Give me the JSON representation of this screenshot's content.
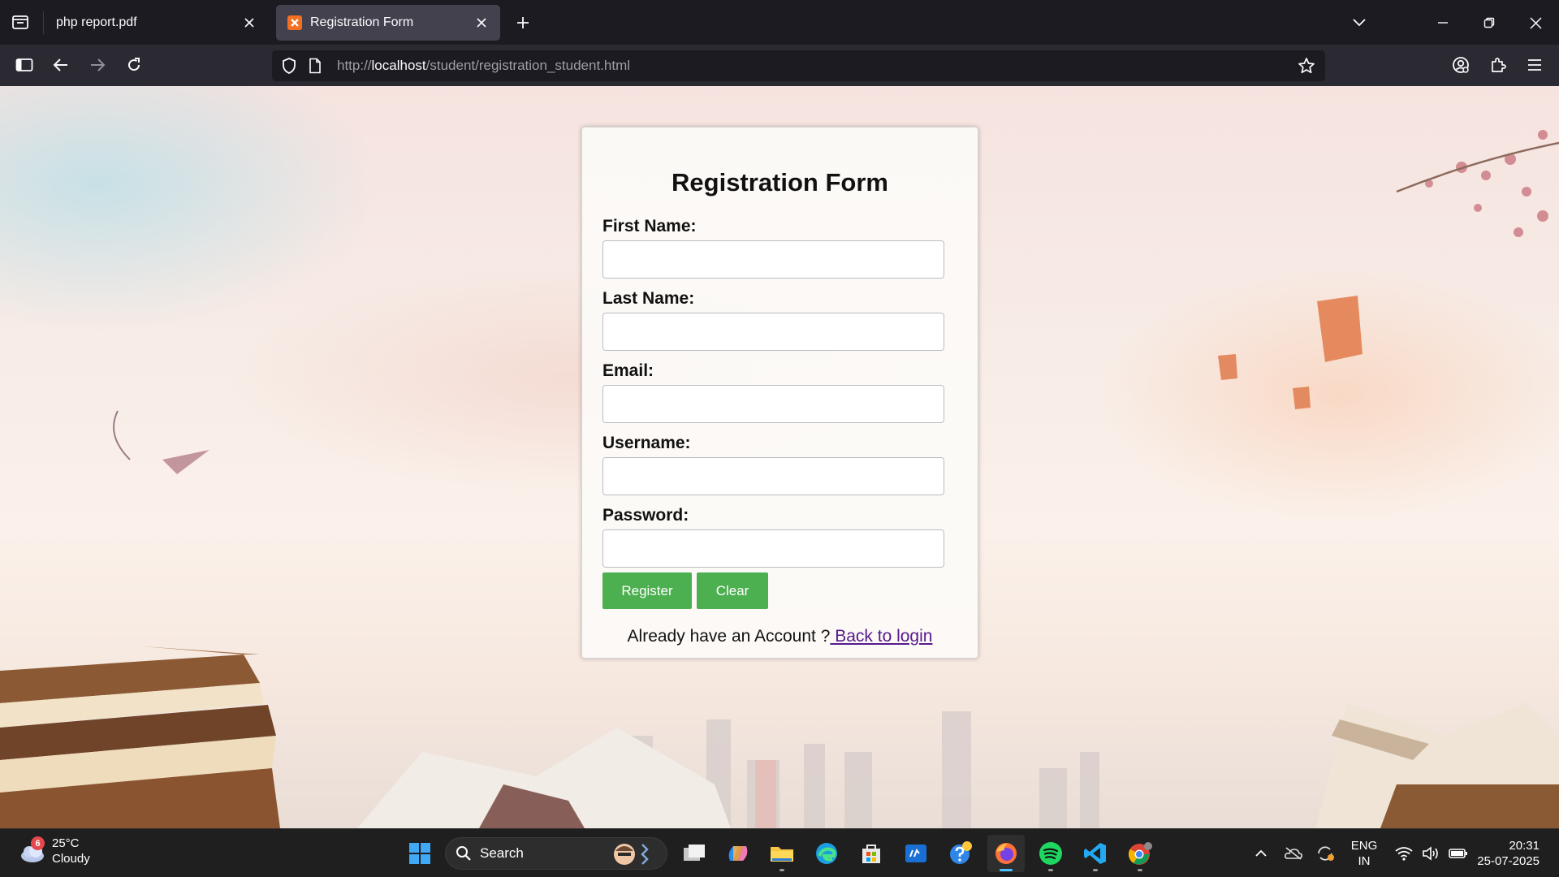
{
  "browser": {
    "tabs": [
      {
        "title": "php report.pdf",
        "active": false
      },
      {
        "title": "Registration Form",
        "active": true
      }
    ],
    "url": {
      "prefix": "http://",
      "host": "localhost",
      "path": "/student/registration_student.html"
    }
  },
  "form": {
    "title": "Registration Form",
    "fields": [
      {
        "label": "First Name:",
        "value": ""
      },
      {
        "label": "Last Name:",
        "value": ""
      },
      {
        "label": "Email:",
        "value": ""
      },
      {
        "label": "Username:",
        "value": ""
      },
      {
        "label": "Password:",
        "value": ""
      }
    ],
    "register_label": "Register",
    "clear_label": "Clear",
    "login_prompt": "Already have an Account ?",
    "login_link": " Back to login",
    "button_color": "#4caf50"
  },
  "taskbar": {
    "weather": {
      "temp": "25°C",
      "condition": "Cloudy",
      "badge": "6"
    },
    "search_placeholder": "Search",
    "language": {
      "line1": "ENG",
      "line2": "IN"
    },
    "clock": {
      "time": "20:31",
      "date": "25-07-2025"
    },
    "apps": [
      "task-view",
      "copilot",
      "file-explorer",
      "edge",
      "microsoft-store",
      "hp-app",
      "help",
      "firefox",
      "spotify",
      "vscode",
      "chrome"
    ]
  }
}
